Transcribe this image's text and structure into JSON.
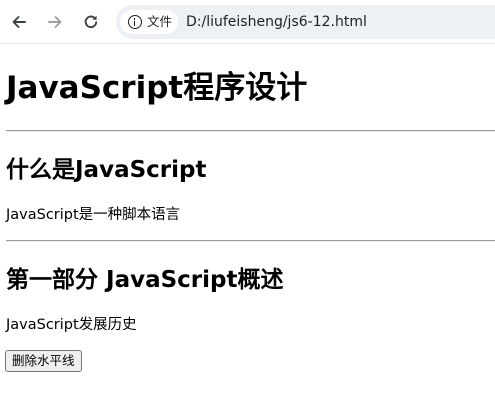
{
  "browser": {
    "security_label": "文件",
    "url": "D:/liufeisheng/js6-12.html",
    "icons": {
      "back": "arrow-left-icon",
      "forward": "arrow-right-icon",
      "reload": "reload-icon",
      "security": "info-icon"
    }
  },
  "content": {
    "title": "JavaScript程序设计",
    "section1": {
      "heading": "什么是JavaScript",
      "text": "JavaScript是一种脚本语言"
    },
    "section2": {
      "heading": "第一部分 JavaScript概述",
      "text": "JavaScript发展历史"
    },
    "button_label": "删除水平线"
  }
}
